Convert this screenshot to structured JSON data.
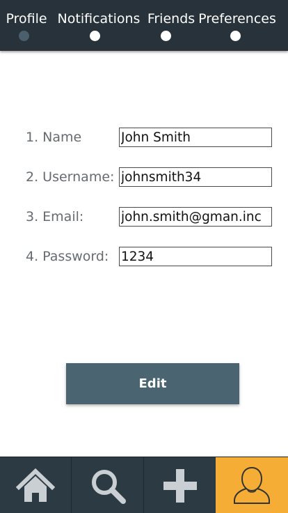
{
  "tabs": [
    {
      "label": "Profile",
      "active": true
    },
    {
      "label": "Notifications",
      "active": false
    },
    {
      "label": "Friends",
      "active": false
    },
    {
      "label": "Preferences",
      "active": false
    }
  ],
  "form": {
    "name": {
      "label": "1. Name",
      "value": "John Smith"
    },
    "username": {
      "label": "2. Username:",
      "value": "johnsmith34"
    },
    "email": {
      "label": "3. Email:",
      "value": "john.smith@gman.inc"
    },
    "password": {
      "label": "4. Password:",
      "value": "1234"
    }
  },
  "edit_button": {
    "label": "Edit"
  },
  "bottom_nav": [
    {
      "icon": "home-icon",
      "active": false
    },
    {
      "icon": "search-icon",
      "active": false
    },
    {
      "icon": "plus-icon",
      "active": false
    },
    {
      "icon": "user-icon",
      "active": true
    }
  ],
  "colors": {
    "topbar": "#27323a",
    "bottom_nav": "#2c3a44",
    "accent": "#f6ad35",
    "button": "#4b6471"
  }
}
